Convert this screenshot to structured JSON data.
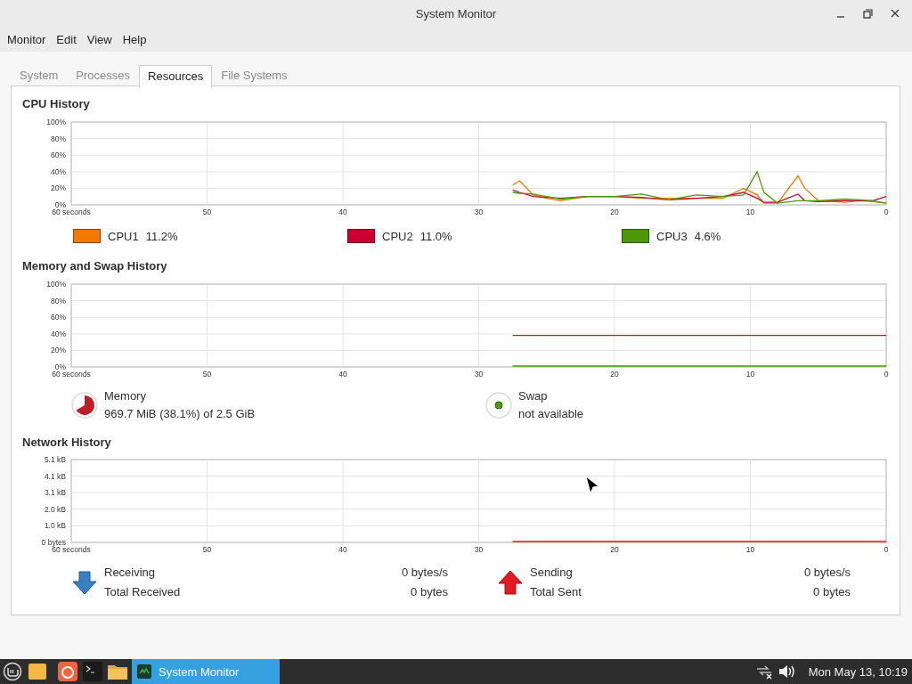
{
  "window": {
    "title": "System Monitor"
  },
  "menu": [
    "Monitor",
    "Edit",
    "View",
    "Help"
  ],
  "tabs": [
    {
      "label": "System",
      "selected": false
    },
    {
      "label": "Processes",
      "selected": false
    },
    {
      "label": "Resources",
      "selected": true
    },
    {
      "label": "File Systems",
      "selected": false
    }
  ],
  "cpu": {
    "title": "CPU History",
    "chart_data": {
      "type": "line",
      "x": [
        27.5,
        27,
        26,
        25,
        24,
        22,
        20,
        18,
        16,
        14,
        12,
        10.5,
        9.5,
        9,
        8,
        6.5,
        6,
        5,
        3,
        2,
        1,
        0
      ],
      "xlim": [
        60,
        0
      ],
      "ylim": [
        0,
        100
      ],
      "xticks": [
        {
          "value": 60,
          "label": "60 seconds"
        },
        50,
        40,
        30,
        20,
        10,
        0
      ],
      "grid": true,
      "yticks": [
        {
          "value": 0,
          "label": "0%"
        },
        {
          "value": 20,
          "label": "20%"
        },
        {
          "value": 40,
          "label": "40%"
        },
        {
          "value": 60,
          "label": "60%"
        },
        {
          "value": 80,
          "label": "80%"
        },
        {
          "value": 100,
          "label": "100%"
        }
      ],
      "series": [
        {
          "name": "CPU1",
          "color": "#f57900",
          "values": [
            24,
            29,
            12,
            8,
            5,
            10,
            10,
            8,
            8,
            8,
            8,
            20,
            12,
            2,
            2,
            35,
            20,
            5,
            3,
            5,
            4,
            2
          ]
        },
        {
          "name": "CPU2",
          "color": "#cc0033",
          "values": [
            18,
            15,
            10,
            9,
            8,
            10,
            10,
            9,
            6,
            8,
            10,
            15,
            8,
            3,
            3,
            13,
            5,
            4,
            5,
            5,
            5,
            10
          ]
        },
        {
          "name": "CPU3",
          "color": "#4e9a06",
          "values": [
            15,
            14,
            13,
            10,
            7,
            10,
            10,
            13,
            6,
            12,
            10,
            12,
            40,
            15,
            2,
            5,
            5,
            5,
            7,
            6,
            5,
            2
          ]
        }
      ]
    },
    "legend": [
      {
        "reading": "11.2%"
      },
      {
        "reading": "11.0%"
      },
      {
        "reading": "4.6%"
      }
    ]
  },
  "memory": {
    "title": "Memory and Swap History",
    "chart_data": {
      "type": "line",
      "x": [
        27.5,
        0
      ],
      "xlim": [
        60,
        0
      ],
      "ylim": [
        0,
        100
      ],
      "xticks": [
        {
          "value": 60,
          "label": "60 seconds"
        },
        50,
        40,
        30,
        20,
        10,
        0
      ],
      "yticks": [
        {
          "value": 0,
          "label": "0%"
        },
        {
          "value": 20,
          "label": "20%"
        },
        {
          "value": 40,
          "label": "40%"
        },
        {
          "value": 60,
          "label": "60%"
        },
        {
          "value": 80,
          "label": "80%"
        },
        {
          "value": 100,
          "label": "100%"
        }
      ],
      "grid": true,
      "series": [
        {
          "name": "Memory",
          "color": "#c01c28",
          "values": [
            38,
            38
          ]
        },
        {
          "name": "Swap",
          "color": "#4e9a06",
          "values": [
            0,
            0
          ]
        }
      ]
    },
    "legend": [
      {
        "kind": "pie",
        "reading": "969.7 MiB (38.1%) of 2.5 GiB"
      },
      {
        "kind": "dot",
        "reading": "not available"
      }
    ]
  },
  "network": {
    "title": "Network History",
    "chart_data": {
      "type": "line",
      "x": [
        27.5,
        0
      ],
      "xlim": [
        60,
        0
      ],
      "ylim": [
        0,
        5.1
      ],
      "xticks": [
        {
          "value": 60,
          "label": "60 seconds"
        },
        50,
        40,
        30,
        20,
        10,
        0
      ],
      "yticks": [
        {
          "value": 0,
          "label": "0 bytes"
        },
        {
          "value": 1.02,
          "label": "1.0 kB"
        },
        {
          "value": 2.04,
          "label": "2.0 kB"
        },
        {
          "value": 3.06,
          "label": "3.1 kB"
        },
        {
          "value": 4.08,
          "label": "4.1 kB"
        },
        {
          "value": 5.1,
          "label": "5.1 kB"
        }
      ],
      "grid": true,
      "series": [
        {
          "name": "Receiving",
          "color": "#3a7fc0",
          "values": [
            null,
            null
          ]
        },
        {
          "name": "Sending",
          "color": "#e01b24",
          "values": [
            0,
            0
          ]
        }
      ]
    },
    "legend": [
      {
        "kind": "down",
        "rate": "0 bytes/s",
        "total_label": "Total Received",
        "total": "0 bytes"
      },
      {
        "kind": "up",
        "rate": "0 bytes/s",
        "total_label": "Total Sent",
        "total": "0 bytes"
      }
    ]
  },
  "taskbar": {
    "tasks": [
      {
        "label": "System Monitor",
        "selected": true
      }
    ],
    "clock": "Mon May 13, 10:19"
  }
}
